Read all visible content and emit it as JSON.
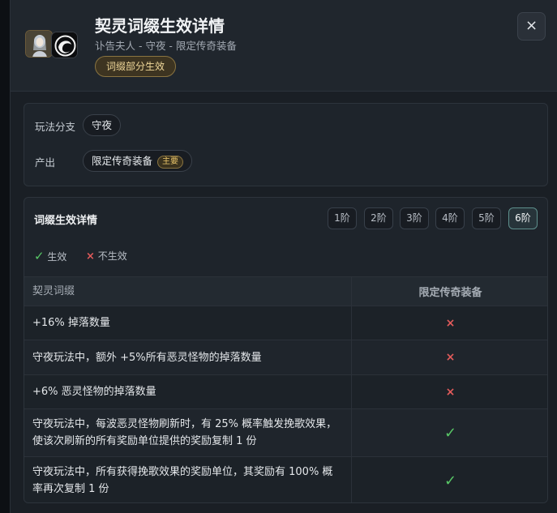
{
  "header": {
    "title": "契灵词缀生效详情",
    "subtitle": "讣告夫人 - 守夜 - 限定传奇装备",
    "status": "词缀部分生效",
    "close_glyph": "×"
  },
  "info": {
    "branch_label": "玩法分支",
    "branch_value": "守夜",
    "output_label": "产出",
    "output_value": "限定传奇装备",
    "output_badge": "主要"
  },
  "details": {
    "title": "词缀生效详情",
    "tiers": [
      "1阶",
      "2阶",
      "3阶",
      "4阶",
      "5阶",
      "6阶"
    ],
    "active_tier": "6阶",
    "legend_active": "生效",
    "legend_inactive": "不生效",
    "legend_active_glyph": "✓",
    "legend_inactive_glyph": "×",
    "col_affix": "契灵词缀",
    "col_target": "限定传奇装备",
    "rows": [
      {
        "text": "+16% 掉落数量",
        "mark": "×"
      },
      {
        "text": "守夜玩法中，额外 +5%所有恶灵怪物的掉落数量",
        "mark": "×"
      },
      {
        "text": "+6% 恶灵怪物的掉落数量",
        "mark": "×"
      },
      {
        "text": "守夜玩法中，每波恶灵怪物刷新时，有 25% 概率触发挽歌效果，使该次刷新的所有奖励单位提供的奖励复制 1 份",
        "mark": "✓"
      },
      {
        "text": "守夜玩法中，所有获得挽歌效果的奖励单位，其奖励有 100% 概率再次复制 1 份",
        "mark": "✓"
      }
    ]
  },
  "colors": {
    "accent_gold": "#f0d89a",
    "active_green": "#58c766",
    "inactive_red": "#e25b5b"
  },
  "icons": {
    "avatar": "character-portrait-icon",
    "emblem": "swirl-emblem-icon"
  }
}
